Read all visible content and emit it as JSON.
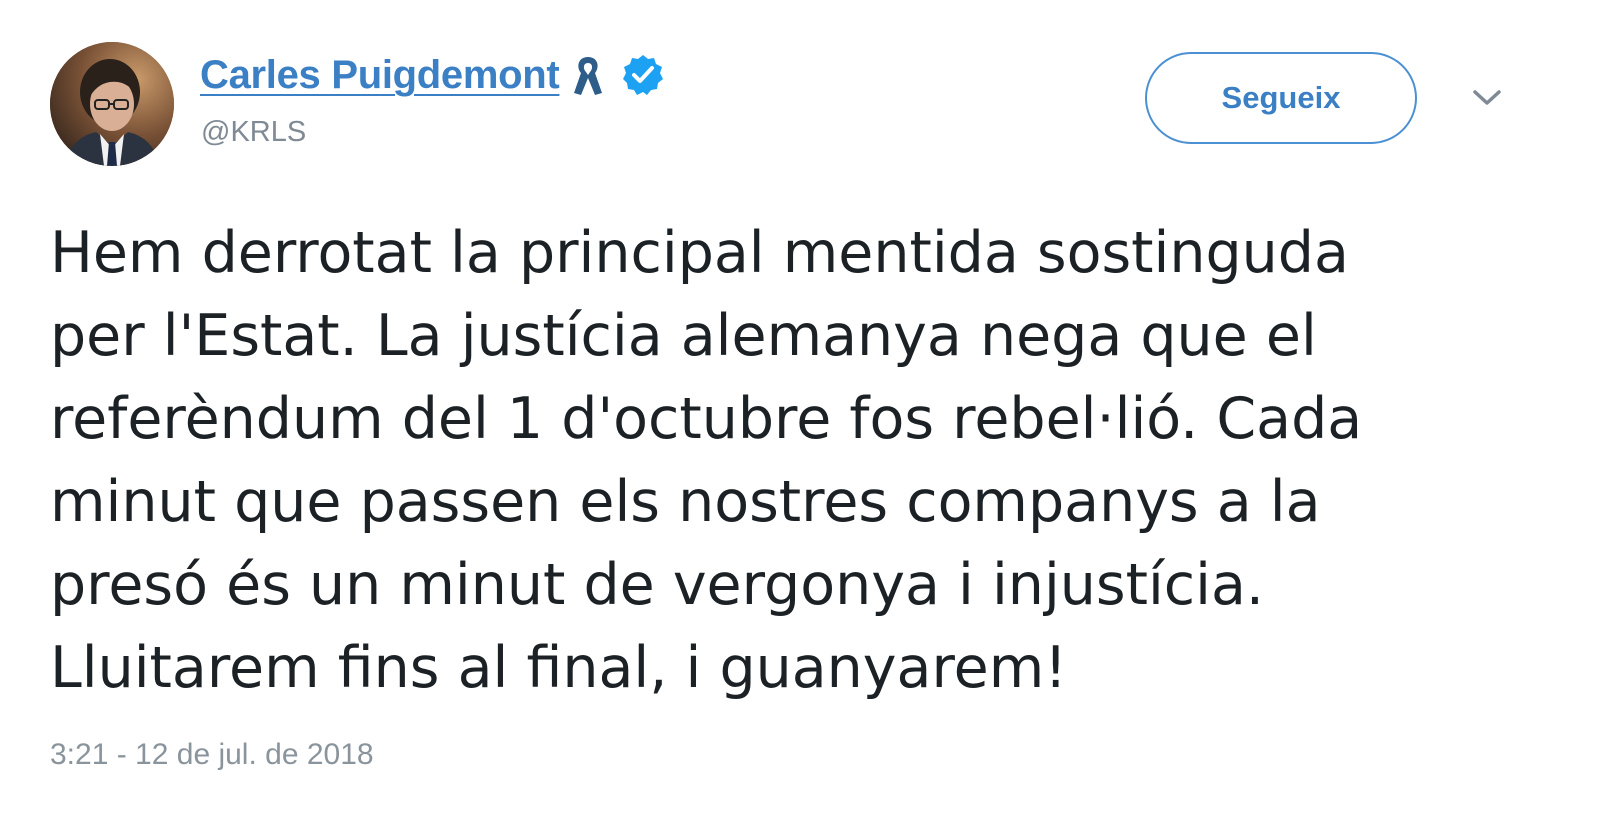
{
  "author": {
    "name": "Carles Puigdemont",
    "handle": "@KRLS",
    "badges": [
      "yellow-ribbon-icon",
      "verified-badge-icon"
    ]
  },
  "actions": {
    "follow_label": "Segueix",
    "more_icon": "chevron-down-icon"
  },
  "tweet": {
    "text": "Hem derrotat la principal mentida sostinguda\nper l'Estat. La justícia alemanya nega que el\nreferèndum del 1 d'octubre fos rebel·lió. Cada\nminut que passen els nostres companys a la\npresó és un minut de vergonya i injustícia.\nLluitarem fins al final, i guanyarem!",
    "timestamp": "3:21 - 12 de jul. de 2018"
  },
  "colors": {
    "link": "#3b7fc4",
    "verified": "#1da1f2",
    "text": "#1c2126",
    "muted": "#8a949c"
  }
}
